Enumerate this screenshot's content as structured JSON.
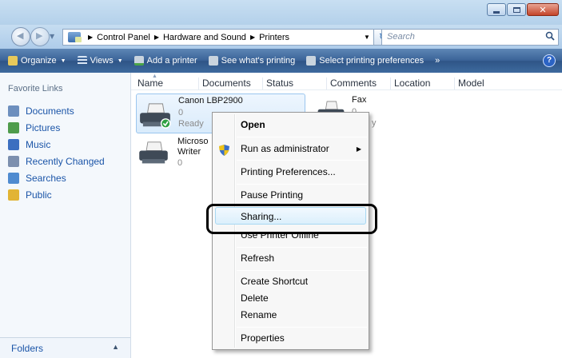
{
  "window": {
    "close_glyph": "✕"
  },
  "address": {
    "crumbs": [
      "Control Panel",
      "Hardware and Sound",
      "Printers"
    ],
    "search_placeholder": "Search"
  },
  "toolbar": {
    "organize": "Organize",
    "views": "Views",
    "add_printer": "Add a printer",
    "see_printing": "See what's printing",
    "select_prefs": "Select printing preferences",
    "more": "»",
    "help": "?"
  },
  "sidebar": {
    "title": "Favorite Links",
    "items": [
      {
        "label": "Documents",
        "color": "#6d8fbe"
      },
      {
        "label": "Pictures",
        "color": "#4f9c4c"
      },
      {
        "label": "Music",
        "color": "#3c6fc0"
      },
      {
        "label": "Recently Changed",
        "color": "#7c8fae"
      },
      {
        "label": "Searches",
        "color": "#4f8bd0"
      },
      {
        "label": "Public",
        "color": "#e2b434"
      }
    ],
    "folders": "Folders"
  },
  "columns": [
    "Name",
    "Documents",
    "Status",
    "Comments",
    "Location",
    "Model"
  ],
  "printers": [
    {
      "name": "Canon LBP2900",
      "docs": "0",
      "status": "Ready"
    },
    {
      "name": "Fax",
      "docs": "0",
      "status": "y"
    },
    {
      "name": "Microso",
      "name2": "Writer",
      "docs": "0"
    }
  ],
  "context_menu": {
    "open": "Open",
    "run_admin": "Run as administrator",
    "printing_prefs": "Printing Preferences...",
    "pause": "Pause Printing",
    "sharing": "Sharing...",
    "use_offline": "Use Printer Offline",
    "refresh": "Refresh",
    "create_shortcut": "Create Shortcut",
    "delete": "Delete",
    "rename": "Rename",
    "properties": "Properties"
  },
  "colors": {
    "toolbar": "#3b6498",
    "link": "#1b55a8",
    "highlight": "#dbeffc"
  }
}
